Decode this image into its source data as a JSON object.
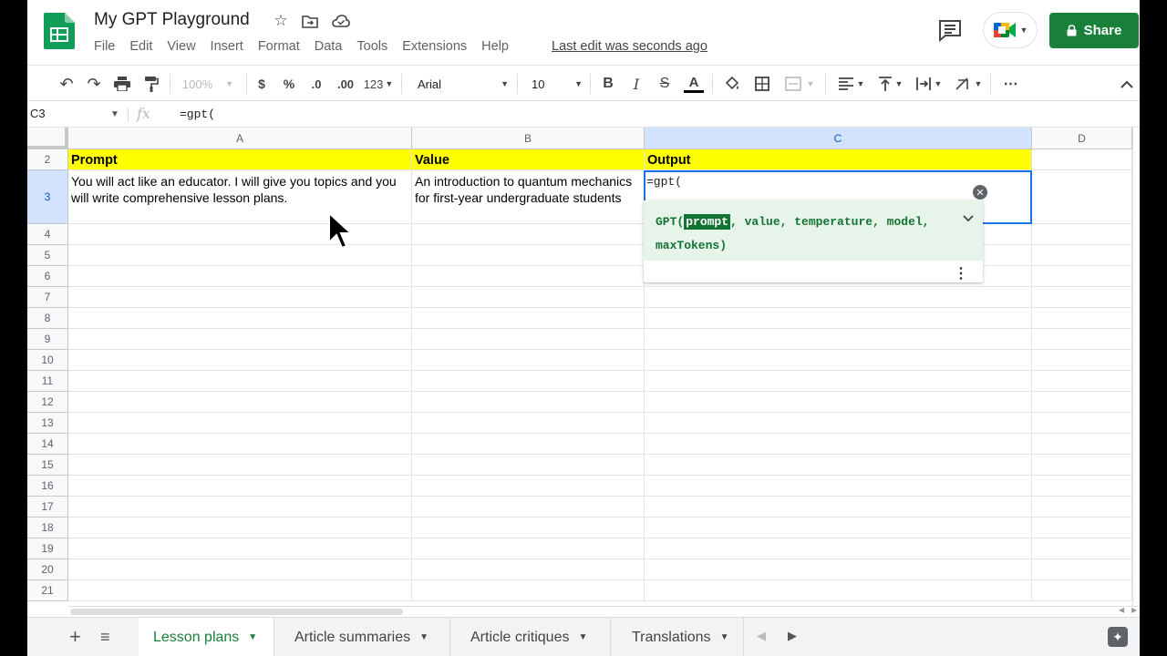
{
  "document": {
    "title": "My GPT Playground",
    "last_edit": "Last edit was seconds ago"
  },
  "menu": [
    "File",
    "Edit",
    "View",
    "Insert",
    "Format",
    "Data",
    "Tools",
    "Extensions",
    "Help"
  ],
  "header_buttons": {
    "share_label": "Share"
  },
  "toolbar": {
    "zoom": "100%",
    "currency": "$",
    "percent": "%",
    "decrease_decimal": ".0",
    "increase_decimal": ".00",
    "more_formats": "123",
    "font": "Arial",
    "font_size": "10",
    "bold": "B",
    "italic": "I",
    "strike": "S",
    "text_color": "A"
  },
  "formula_bar": {
    "cell_ref": "C3",
    "fx": "fx",
    "formula": "=gpt("
  },
  "columns": [
    "A",
    "B",
    "C",
    "D"
  ],
  "rows": [
    "2",
    "3",
    "4",
    "5",
    "6",
    "7",
    "8",
    "9",
    "10",
    "11",
    "12",
    "13",
    "14",
    "15",
    "16",
    "17",
    "18",
    "19",
    "20",
    "21"
  ],
  "cells": {
    "A2": "Prompt",
    "B2": "Value",
    "C2": "Output",
    "A3": "You will act like an educator. I will give you topics and you will write comprehensive lesson plans.",
    "B3": "An introduction to quantum mechanics for first-year undergraduate students",
    "C3": "=gpt("
  },
  "autocomplete": {
    "fn_open": "GPT(",
    "highlighted_param": "prompt",
    "rest_params": ", value, temperature, model, maxTokens)"
  },
  "sheet_tabs": [
    "Lesson plans",
    "Article summaries",
    "Article critiques",
    "Translations"
  ],
  "active_tab": "Lesson plans",
  "colors": {
    "header_yellow": "#ffff00",
    "share_green": "#188038",
    "active_tab_green": "#188038",
    "selection_blue": "#1a73e8",
    "autocomplete_bg": "#e6f4ea"
  }
}
